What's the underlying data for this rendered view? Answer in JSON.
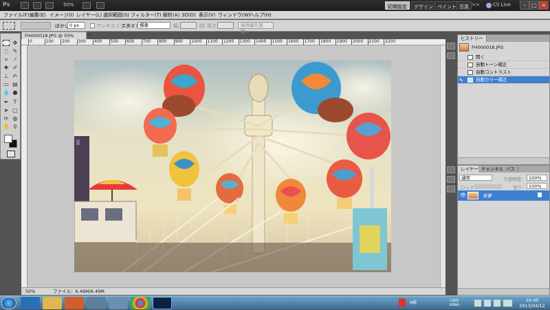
{
  "appbar": {
    "logo": "Ps",
    "zoom": "50%",
    "workspaces": [
      "初期設定",
      "デザイン",
      "ペイント",
      "写真"
    ],
    "more": ">>",
    "cslive": "CS Live",
    "window_controls": [
      "minimize-icon",
      "restore-icon",
      "close-icon"
    ]
  },
  "menubar": {
    "items": [
      "ファイル(F)",
      "編集(E)",
      "イメージ(I)",
      "レイヤー(L)",
      "選択範囲(S)",
      "フィルター(T)",
      "解析(A)",
      "3D(D)",
      "表示(V)",
      "ウィンドウ(W)",
      "ヘルプ(H)"
    ]
  },
  "options": {
    "blur_label": "ぼかし:",
    "blur_value": "0 px",
    "antialias_label": "アンチエイリアス",
    "style_label": "スタイル:",
    "style_value": "標準",
    "width_label": "幅:",
    "height_label": "高さ:",
    "refine_button": "境界線を調整..."
  },
  "document": {
    "tab_title": "FH000018.JPG @ 50% (RGB/8) *",
    "ruler_ticks": [
      "0",
      "100",
      "200",
      "300",
      "400",
      "500",
      "600",
      "700",
      "800",
      "900",
      "1000",
      "1100",
      "1200",
      "1300",
      "1400",
      "1500",
      "1600",
      "1700",
      "1800",
      "1900",
      "2000",
      "2100",
      "2200"
    ],
    "status_zoom": "50%",
    "status_file": "ファイル：6.49M/6.49M"
  },
  "history": {
    "tab_label": "ヒストリー",
    "snapshot_name": "FH000018.JPG",
    "rows": [
      "開く",
      "自動トーン補正",
      "自動コントラスト",
      "自動カラー補正"
    ],
    "selected_index": 3
  },
  "layers": {
    "tabs": [
      "レイヤー",
      "チャンネル",
      "パス"
    ],
    "blend_mode": "通常",
    "opacity_label": "不透明度:",
    "opacity_value": "100%",
    "lock_label": "ロック:",
    "fill_label": "塗り:",
    "fill_value": "100%",
    "layer_name": "背景"
  },
  "taskbar": {
    "clock_time": "10:40",
    "clock_date": "2013/04/12",
    "ime": "A般",
    "caps": "CAPS KANA"
  },
  "colors": {
    "selection": "#3d7fd1",
    "app_dark": "#535353",
    "panel": "#d6d6d6"
  }
}
